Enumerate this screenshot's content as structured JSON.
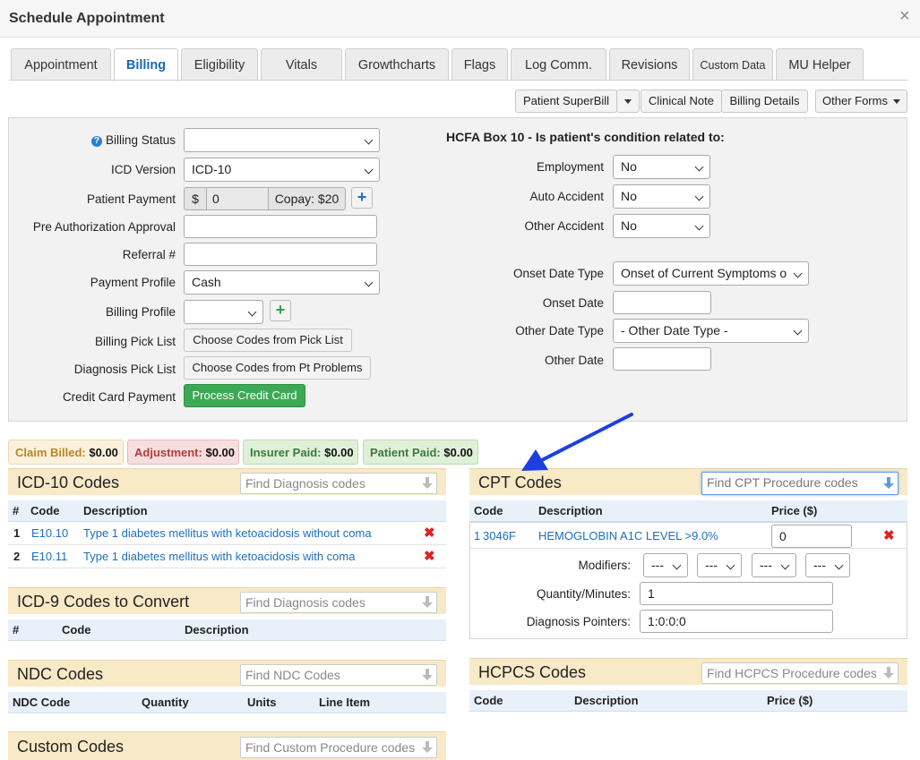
{
  "window": {
    "title": "Schedule Appointment",
    "close": "×"
  },
  "tabs": [
    {
      "label": "Appointment"
    },
    {
      "label": "Billing"
    },
    {
      "label": "Eligibility"
    },
    {
      "label": "Vitals"
    },
    {
      "label": "Growthcharts"
    },
    {
      "label": "Flags"
    },
    {
      "label": "Log Comm."
    },
    {
      "label": "Revisions"
    },
    {
      "label": "Custom Data"
    },
    {
      "label": "MU Helper"
    }
  ],
  "toolbar": {
    "patient_superbill": "Patient SuperBill",
    "clinical_note": "Clinical Note",
    "billing_details": "Billing Details",
    "other_forms": "Other Forms"
  },
  "billing_form": {
    "billing_status": {
      "label": "Billing Status",
      "value": ""
    },
    "icd_version": {
      "label": "ICD Version",
      "value": "ICD-10"
    },
    "patient_payment": {
      "label": "Patient Payment",
      "currency": "$",
      "value": "0",
      "copay": "Copay: $20"
    },
    "pre_auth": {
      "label": "Pre Authorization Approval",
      "value": ""
    },
    "referral": {
      "label": "Referral #",
      "value": ""
    },
    "payment_profile": {
      "label": "Payment Profile",
      "value": "Cash"
    },
    "billing_profile": {
      "label": "Billing Profile",
      "value": ""
    },
    "billing_pick_list": {
      "label": "Billing Pick List",
      "button": "Choose Codes from Pick List"
    },
    "diagnosis_pick_list": {
      "label": "Diagnosis Pick List",
      "button": "Choose Codes from Pt Problems"
    },
    "credit_card": {
      "label": "Credit Card Payment",
      "button": "Process Credit Card"
    }
  },
  "hcfa": {
    "title": "HCFA Box 10 - Is patient's condition related to:",
    "employment": {
      "label": "Employment",
      "value": "No"
    },
    "auto_accident": {
      "label": "Auto Accident",
      "value": "No"
    },
    "other_accident": {
      "label": "Other Accident",
      "value": "No"
    },
    "onset_date_type": {
      "label": "Onset Date Type",
      "value": "Onset of Current Symptoms o"
    },
    "onset_date": {
      "label": "Onset Date",
      "value": ""
    },
    "other_date_type": {
      "label": "Other Date Type",
      "value": "- Other Date Type -"
    },
    "other_date": {
      "label": "Other Date",
      "value": ""
    }
  },
  "summary": {
    "claim_billed": {
      "label": "Claim Billed:",
      "value": "$0.00"
    },
    "adjustment": {
      "label": "Adjustment:",
      "value": "$0.00"
    },
    "insurer_paid": {
      "label": "Insurer Paid:",
      "value": "$0.00"
    },
    "patient_paid": {
      "label": "Patient Paid:",
      "value": "$0.00"
    }
  },
  "icd10": {
    "title": "ICD-10 Codes",
    "search_placeholder": "Find Diagnosis codes",
    "columns": [
      "#",
      "Code",
      "Description"
    ],
    "rows": [
      {
        "num": "1",
        "code": "E10.10",
        "desc": "Type 1 diabetes mellitus with ketoacidosis without coma"
      },
      {
        "num": "2",
        "code": "E10.11",
        "desc": "Type 1 diabetes mellitus with ketoacidosis with coma"
      }
    ]
  },
  "icd9": {
    "title": "ICD-9 Codes to Convert",
    "search_placeholder": "Find Diagnosis codes",
    "columns": [
      "#",
      "Code",
      "Description"
    ]
  },
  "ndc": {
    "title": "NDC Codes",
    "search_placeholder": "Find NDC Codes",
    "columns": [
      "NDC Code",
      "Quantity",
      "Units",
      "Line Item"
    ]
  },
  "custom": {
    "title": "Custom Codes",
    "search_placeholder": "Find Custom Procedure codes"
  },
  "cpt": {
    "title": "CPT Codes",
    "search_placeholder": "Find CPT Procedure codes",
    "columns": [
      "Code",
      "Description",
      "Price ($)"
    ],
    "row": {
      "num": "1",
      "code": "3046F",
      "desc": "HEMOGLOBIN A1C LEVEL >9.0%",
      "price": "0"
    },
    "modifiers_label": "Modifiers:",
    "modifier_value": "---",
    "quantity_label": "Quantity/Minutes:",
    "quantity_value": "1",
    "pointers_label": "Diagnosis Pointers:",
    "pointers_value": "1:0:0:0"
  },
  "hcpcs": {
    "title": "HCPCS Codes",
    "search_placeholder": "Find HCPCS Procedure codes",
    "columns": [
      "Code",
      "Description",
      "Price ($)"
    ]
  },
  "colors": {
    "accent": "#1769b5",
    "arrow": "#1d3fe0",
    "green": "#3caa54",
    "section": "#f8e9c7"
  }
}
